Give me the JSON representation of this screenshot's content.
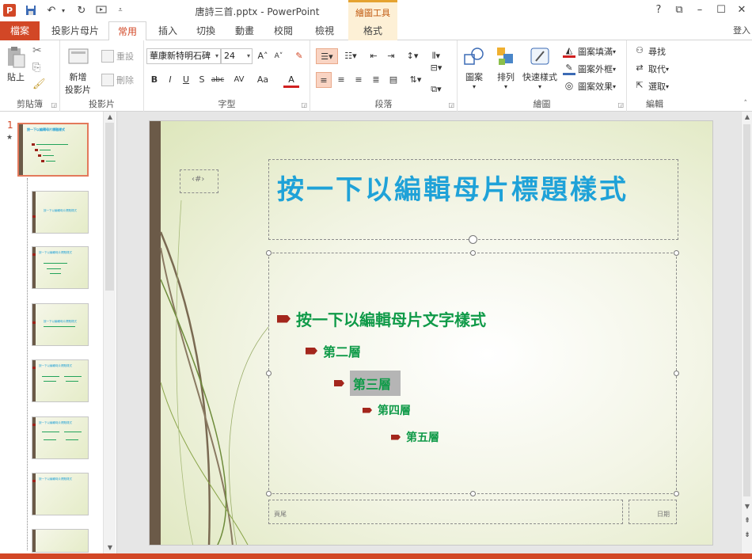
{
  "titlebar": {
    "doc_title": "唐詩三首.pptx - PowerPoint",
    "context_tab_header": "繪圖工具",
    "help": "?",
    "ribbon_options": "⧉",
    "minimize": "–",
    "maximize": "☐",
    "close": "✕"
  },
  "tabs": {
    "file": "檔案",
    "items": [
      "投影片母片",
      "常用",
      "插入",
      "切換",
      "動畫",
      "校閱",
      "檢視",
      "格式"
    ],
    "active": "常用",
    "signin": "登入"
  },
  "ribbon": {
    "clipboard": {
      "label": "剪貼簿",
      "paste": "貼上"
    },
    "slides": {
      "label": "投影片",
      "new_slide_line1": "新增",
      "new_slide_line2": "投影片",
      "reset": "重設",
      "delete": "刪除"
    },
    "font": {
      "label": "字型",
      "font_name": "華康新特明石碑",
      "font_size": "24",
      "bold": "B",
      "italic": "I",
      "underline": "U",
      "shadow": "S",
      "strike": "abc",
      "spacing": "AV",
      "case": "Aa",
      "color_a": "A",
      "grow": "A˄",
      "shrink": "A˅"
    },
    "paragraph": {
      "label": "段落"
    },
    "drawing": {
      "label": "繪圖",
      "shapes": "圖案",
      "arrange": "排列",
      "quick_styles": "快速樣式",
      "shape_fill": "圖案填滿",
      "shape_outline": "圖案外框",
      "shape_effects": "圖案效果"
    },
    "editing": {
      "label": "編輯",
      "find": "尋找",
      "replace": "取代",
      "select": "選取"
    }
  },
  "thumbnails": {
    "master_number": "1",
    "master_star": "★",
    "master_title": "按一下以編輯母片標題樣式",
    "layouts": [
      {
        "title": "按一下以編輯母片標題樣式"
      },
      {
        "title": "按一下以編輯母片標題樣式"
      },
      {
        "title": "按一下以編輯母片標題樣式"
      },
      {
        "title": "按一下以編輯母片標題樣式"
      },
      {
        "title": "按一下以編輯母片標題樣式"
      },
      {
        "title": "按一下以編輯母片標題樣式"
      },
      {
        "title": ""
      }
    ]
  },
  "slide": {
    "title": "按一下以編輯母片標題樣式",
    "number_placeholder": "‹#›",
    "levels": [
      "按一下以編輯母片文字樣式",
      "第二層",
      "第三層",
      "第四層",
      "第五層"
    ],
    "footer": "頁尾",
    "date": "日期"
  },
  "colors": {
    "accent": "#d24726",
    "title_blue": "#1fa2d8",
    "body_green": "#0f9a48",
    "bullet_red": "#a3261c",
    "side_bar": "#6b5a48"
  }
}
